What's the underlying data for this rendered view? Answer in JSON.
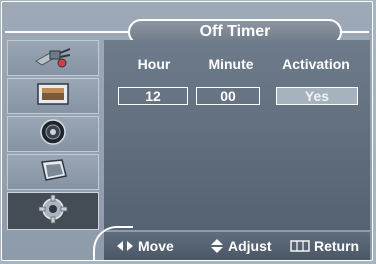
{
  "menu": {
    "title": "Off Timer",
    "columns": {
      "hour": {
        "label": "Hour",
        "value": "12"
      },
      "minute": {
        "label": "Minute",
        "value": "00"
      },
      "activation": {
        "label": "Activation",
        "value": "Yes"
      }
    }
  },
  "sidebar": {
    "items": [
      {
        "name": "input-icon",
        "active": false
      },
      {
        "name": "picture-icon",
        "active": false
      },
      {
        "name": "sound-icon",
        "active": false
      },
      {
        "name": "channel-icon",
        "active": false
      },
      {
        "name": "setup-gear-icon",
        "active": true
      }
    ]
  },
  "footer": {
    "move": "Move",
    "adjust": "Adjust",
    "return": "Return"
  }
}
